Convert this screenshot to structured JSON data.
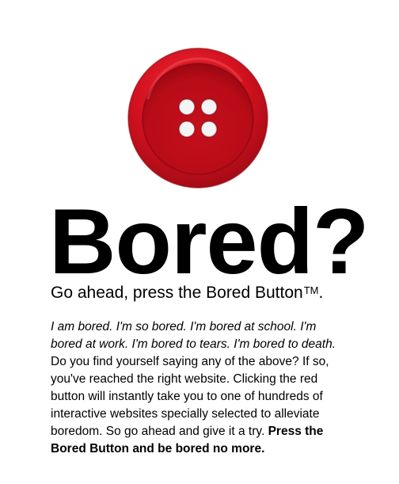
{
  "button": {
    "icon": "red-button-icon",
    "color": "#d4121f"
  },
  "headline": "Bored?",
  "tagline": {
    "text": "Go ahead, press the Bored Button",
    "trademark": "TM",
    "end": "."
  },
  "description": {
    "italic_intro": "I am bored. I'm so bored. I'm bored at school. I'm bored at work. I'm bored to tears. I'm bored to death.",
    "body": " Do you find yourself saying any of the above? If so, you've reached the right website. Clicking the red button will instantly take you to one of hundreds of interactive websites specially selected to alleviate boredom. So go ahead and give it a try. ",
    "bold_outro": "Press the Bored Button and be bored no more."
  }
}
